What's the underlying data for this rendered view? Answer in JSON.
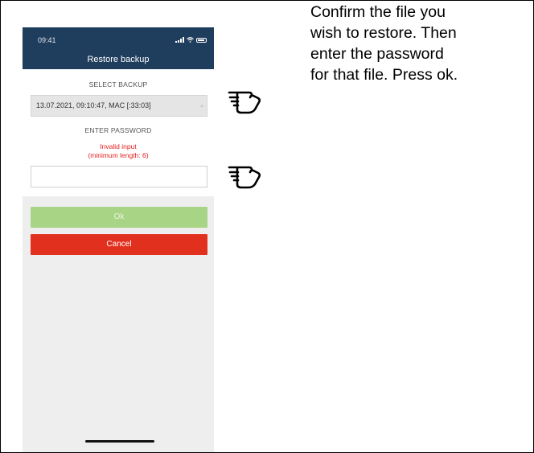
{
  "phone": {
    "status_time": "09:41",
    "title": "Restore backup",
    "select_backup_label": "SELECT BACKUP",
    "backup_selected": "13.07.2021, 09:10:47, MAC [:33:03]",
    "enter_password_label": "ENTER PASSWORD",
    "error_line1": "Invalid input",
    "error_line2": "(minimum length: 6)",
    "password_value": "",
    "ok_label": "Ok",
    "cancel_label": "Cancel"
  },
  "instructions": {
    "line1": "Confirm the file you",
    "line2": "wish to restore. Then",
    "line3": "enter the password",
    "line4": "for that file. Press ok."
  },
  "colors": {
    "header": "#1f3d5c",
    "ok_button": "#a8d485",
    "cancel_button": "#e2301f",
    "error_text": "#e32121",
    "phone_background": "#eeeeee"
  },
  "icons": [
    "pointing-hand-icon",
    "pointing-hand-icon",
    "signal-icon",
    "wifi-icon",
    "battery-icon",
    "dropdown-arrow-icon"
  ]
}
